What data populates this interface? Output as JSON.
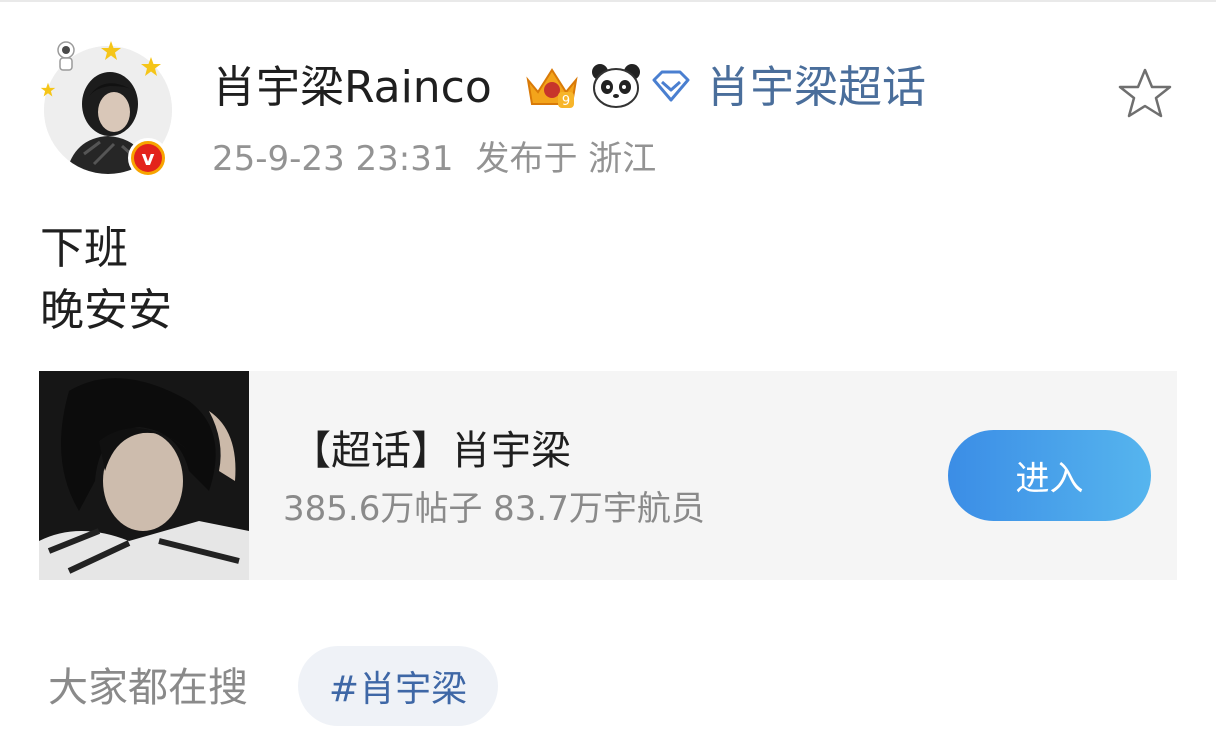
{
  "post": {
    "username": "肖宇梁Rainco",
    "supertopic_link": "肖宇梁超话",
    "timestamp": "25-9-23 23:31",
    "location": "发布于 浙江",
    "text_lines": [
      "下班",
      "晚安安"
    ]
  },
  "card": {
    "title": "【超话】肖宇梁",
    "stats": "385.6万帖子 83.7万宇航员",
    "enter_label": "进入"
  },
  "search": {
    "label": "大家都在搜",
    "tag": "#肖宇梁"
  },
  "icons": {
    "avatar_badge": "verified-v-icon",
    "member_badge": "crown-icon",
    "emoji_badge": "panda-icon",
    "topic_badge": "diamond-icon",
    "favorite": "star-icon"
  },
  "colors": {
    "link": "#4a6e9b",
    "button_start": "#3b8de6",
    "button_end": "#56b5ee",
    "meta_text": "#939393",
    "card_bg": "#f5f5f5",
    "verified_badge": "#e3231b"
  }
}
